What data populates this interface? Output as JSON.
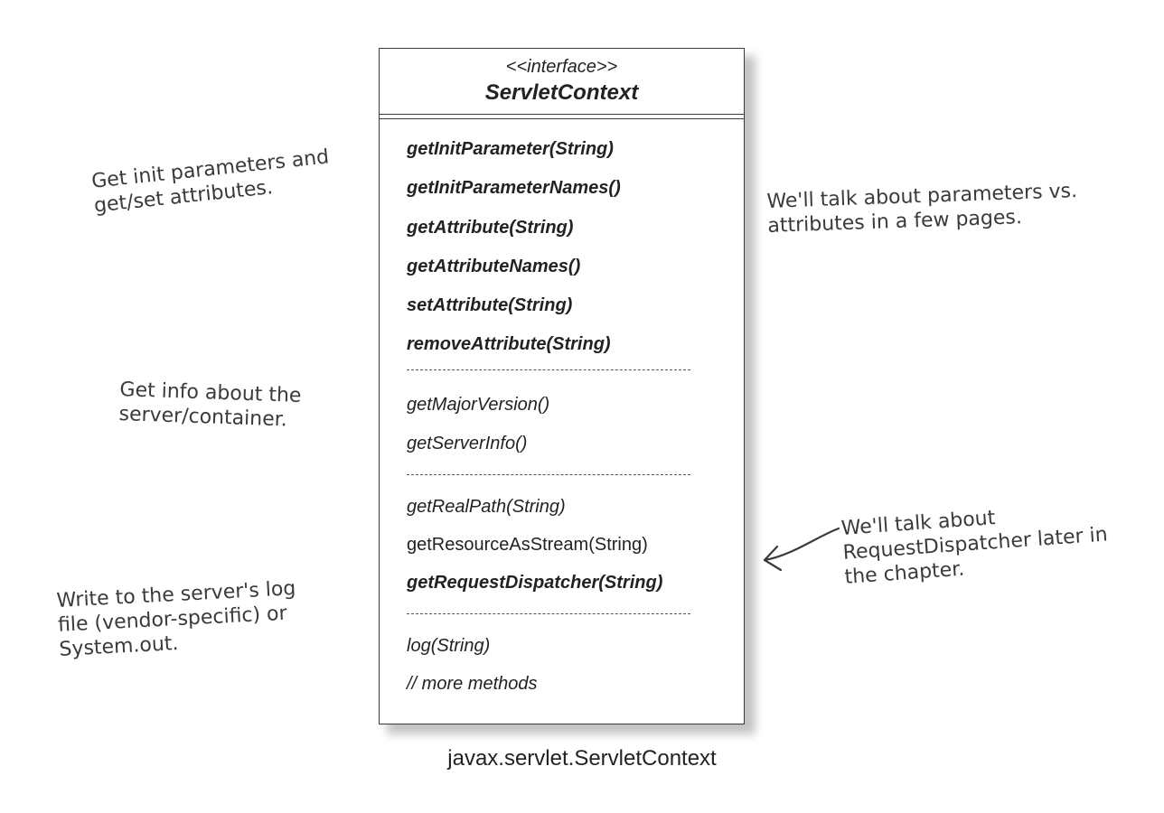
{
  "uml_class": {
    "stereotype": "<<interface>>",
    "name": "ServletContext",
    "methods": [
      {
        "text": "getInitParameter(String)",
        "style": "bold-italic"
      },
      {
        "text": "getInitParameterNames()",
        "style": "bold-italic"
      },
      {
        "text": "getAttribute(String)",
        "style": "bold-italic"
      },
      {
        "text": "getAttributeNames()",
        "style": "bold-italic"
      },
      {
        "text": "setAttribute(String)",
        "style": "bold-italic"
      },
      {
        "text": "removeAttribute(String)",
        "style": "bold-italic"
      },
      {
        "text": "getMajorVersion()",
        "style": "italic"
      },
      {
        "text": "getServerInfo()",
        "style": "italic"
      },
      {
        "text": "getRealPath(String)",
        "style": "italic"
      },
      {
        "text": "getResourceAsStream(String)",
        "style": "normal"
      },
      {
        "text": "getRequestDispatcher(String)",
        "style": "bold-italic"
      },
      {
        "text": "log(String)",
        "style": "italic"
      },
      {
        "text": "// more methods",
        "style": "italic"
      }
    ]
  },
  "caption": "javax.servlet.ServletContext",
  "notes": {
    "init_params": [
      "Get init parameters and",
      "get/set attributes."
    ],
    "server_info": [
      "Get info about the",
      "server/container."
    ],
    "log": [
      "Write to the server's log",
      "file (vendor-specific) or",
      "System.out."
    ],
    "params_vs_attrs": [
      "We'll talk about parameters vs.",
      "attributes in a few pages."
    ],
    "dispatcher": [
      "We'll talk about",
      "RequestDispatcher later in",
      "the chapter."
    ]
  },
  "colors": {
    "ink": "#222222",
    "handwriting": "#3a3a3a"
  }
}
